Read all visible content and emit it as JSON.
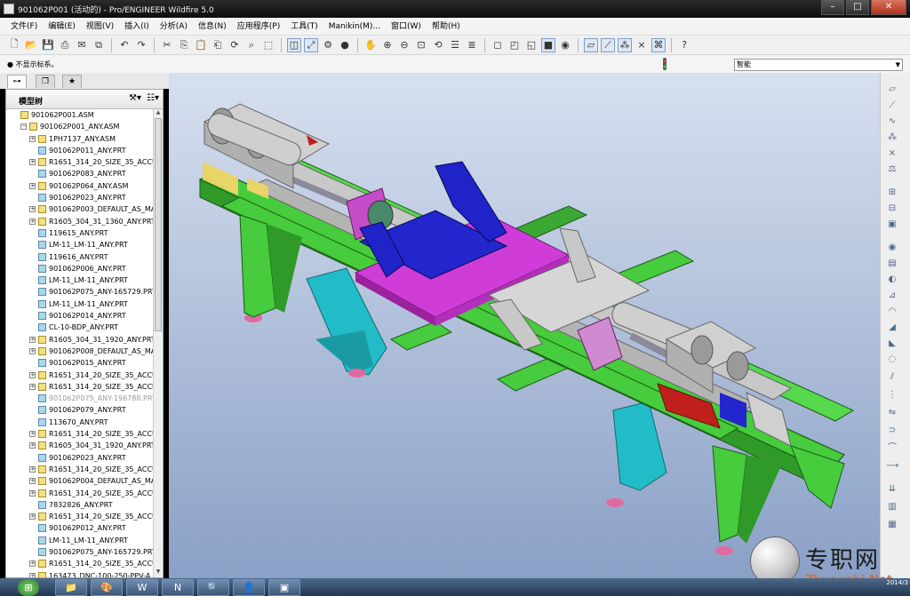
{
  "window": {
    "title": "901062P001 (活动的) - Pro/ENGINEER Wildfire 5.0",
    "controls": [
      "–",
      "□",
      "✕"
    ]
  },
  "menu": [
    "文件(F)",
    "编辑(E)",
    "视图(V)",
    "插入(I)",
    "分析(A)",
    "信息(N)",
    "应用程序(P)",
    "工具(T)",
    "Manikin(M)...",
    "窗口(W)",
    "帮助(H)"
  ],
  "message": "● 不显示标系。",
  "filter": {
    "value": "智能"
  },
  "navigator": {
    "tabs": [
      "model-tree",
      "folder-browser",
      "favorites"
    ],
    "title": "模型树",
    "tree": [
      {
        "label": "901062P001.ASM",
        "type": "asm",
        "level": 0,
        "expand": ""
      },
      {
        "label": "901062P001_ANY.ASM",
        "type": "asm",
        "level": 1,
        "expand": "−"
      },
      {
        "label": "1PH7137_ANY.ASM",
        "type": "asm",
        "level": 2,
        "expand": "+"
      },
      {
        "label": "901062P011_ANY.PRT",
        "type": "prt",
        "level": 2,
        "expand": ""
      },
      {
        "label": "R1651_314_20_SIZE_35_ACCU",
        "type": "asm",
        "level": 2,
        "expand": "+"
      },
      {
        "label": "901062P083_ANY.PRT",
        "type": "prt",
        "level": 2,
        "expand": ""
      },
      {
        "label": "901062P064_ANY.ASM",
        "type": "asm",
        "level": 2,
        "expand": "+"
      },
      {
        "label": "901062P023_ANY.PRT",
        "type": "prt",
        "level": 2,
        "expand": ""
      },
      {
        "label": "901062P003_DEFAULT_AS_MA",
        "type": "asm",
        "level": 2,
        "expand": "+"
      },
      {
        "label": "R1605_304_31_1360_ANY.PRT",
        "type": "asm",
        "level": 2,
        "expand": "+"
      },
      {
        "label": "119615_ANY.PRT",
        "type": "prt",
        "level": 2,
        "expand": ""
      },
      {
        "label": "LM-11_LM-11_ANY.PRT",
        "type": "prt",
        "level": 2,
        "expand": ""
      },
      {
        "label": "119616_ANY.PRT",
        "type": "prt",
        "level": 2,
        "expand": ""
      },
      {
        "label": "901062P006_ANY.PRT",
        "type": "prt",
        "level": 2,
        "expand": ""
      },
      {
        "label": "LM-11_LM-11_ANY.PRT",
        "type": "prt",
        "level": 2,
        "expand": ""
      },
      {
        "label": "901062P075_ANY-165729.PRT",
        "type": "prt",
        "level": 2,
        "expand": ""
      },
      {
        "label": "LM-11_LM-11_ANY.PRT",
        "type": "prt",
        "level": 2,
        "expand": ""
      },
      {
        "label": "901062P014_ANY.PRT",
        "type": "prt",
        "level": 2,
        "expand": ""
      },
      {
        "label": "CL-10-BDP_ANY.PRT",
        "type": "prt",
        "level": 2,
        "expand": ""
      },
      {
        "label": "R1605_304_31_1920_ANY.PRT",
        "type": "asm",
        "level": 2,
        "expand": "+"
      },
      {
        "label": "901062P008_DEFAULT_AS_MA",
        "type": "asm",
        "level": 2,
        "expand": "+"
      },
      {
        "label": "901062P015_ANY.PRT",
        "type": "prt",
        "level": 2,
        "expand": ""
      },
      {
        "label": "R1651_314_20_SIZE_35_ACCU",
        "type": "asm",
        "level": 2,
        "expand": "+"
      },
      {
        "label": "R1651_314_20_SIZE_35_ACCU",
        "type": "asm",
        "level": 2,
        "expand": "+"
      },
      {
        "label": "901062P075_ANY-196788.PRT",
        "type": "prt",
        "level": 2,
        "expand": "",
        "dim": true
      },
      {
        "label": "901062P079_ANY.PRT",
        "type": "prt",
        "level": 2,
        "expand": ""
      },
      {
        "label": "113670_ANY.PRT",
        "type": "prt",
        "level": 2,
        "expand": ""
      },
      {
        "label": "R1651_314_20_SIZE_35_ACCU",
        "type": "asm",
        "level": 2,
        "expand": "+"
      },
      {
        "label": "R1605_304_31_1920_ANY.PRT",
        "type": "asm",
        "level": 2,
        "expand": "+"
      },
      {
        "label": "901062P023_ANY.PRT",
        "type": "prt",
        "level": 2,
        "expand": ""
      },
      {
        "label": "R1651_314_20_SIZE_35_ACCU",
        "type": "asm",
        "level": 2,
        "expand": "+"
      },
      {
        "label": "901062P004_DEFAULT_AS_MA",
        "type": "asm",
        "level": 2,
        "expand": "+"
      },
      {
        "label": "R1651_314_20_SIZE_35_ACCU",
        "type": "asm",
        "level": 2,
        "expand": "+"
      },
      {
        "label": "7832826_ANY.PRT",
        "type": "prt",
        "level": 2,
        "expand": ""
      },
      {
        "label": "R1651_314_20_SIZE_35_ACCU",
        "type": "asm",
        "level": 2,
        "expand": "+"
      },
      {
        "label": "901062P012_ANY.PRT",
        "type": "prt",
        "level": 2,
        "expand": ""
      },
      {
        "label": "LM-11_LM-11_ANY.PRT",
        "type": "prt",
        "level": 2,
        "expand": ""
      },
      {
        "label": "901062P075_ANY-165729.PRT",
        "type": "prt",
        "level": 2,
        "expand": ""
      },
      {
        "label": "R1651_314_20_SIZE_35_ACCU",
        "type": "asm",
        "level": 2,
        "expand": "+"
      },
      {
        "label": "163473_DNC-100-250-PPV-A",
        "type": "asm",
        "level": 2,
        "expand": "+"
      }
    ]
  },
  "taskbar": {
    "apps": [
      "folder",
      "paint",
      "word",
      "onenote",
      "search",
      "person",
      "proe"
    ],
    "clock_time": "",
    "clock_date": "2014/3"
  },
  "watermark": {
    "cn": "专职网",
    "en": "Zhuanzhi.Net"
  },
  "colors": {
    "frame_green": "#46cc3c",
    "plate_blue": "#1f23c8",
    "plate_magenta": "#c02cd4",
    "cyan_support": "#22bcc8",
    "steel_gray": "#c8c8c8",
    "viewport_top": "#d7e0ef",
    "viewport_bottom": "#8aa0c6"
  }
}
